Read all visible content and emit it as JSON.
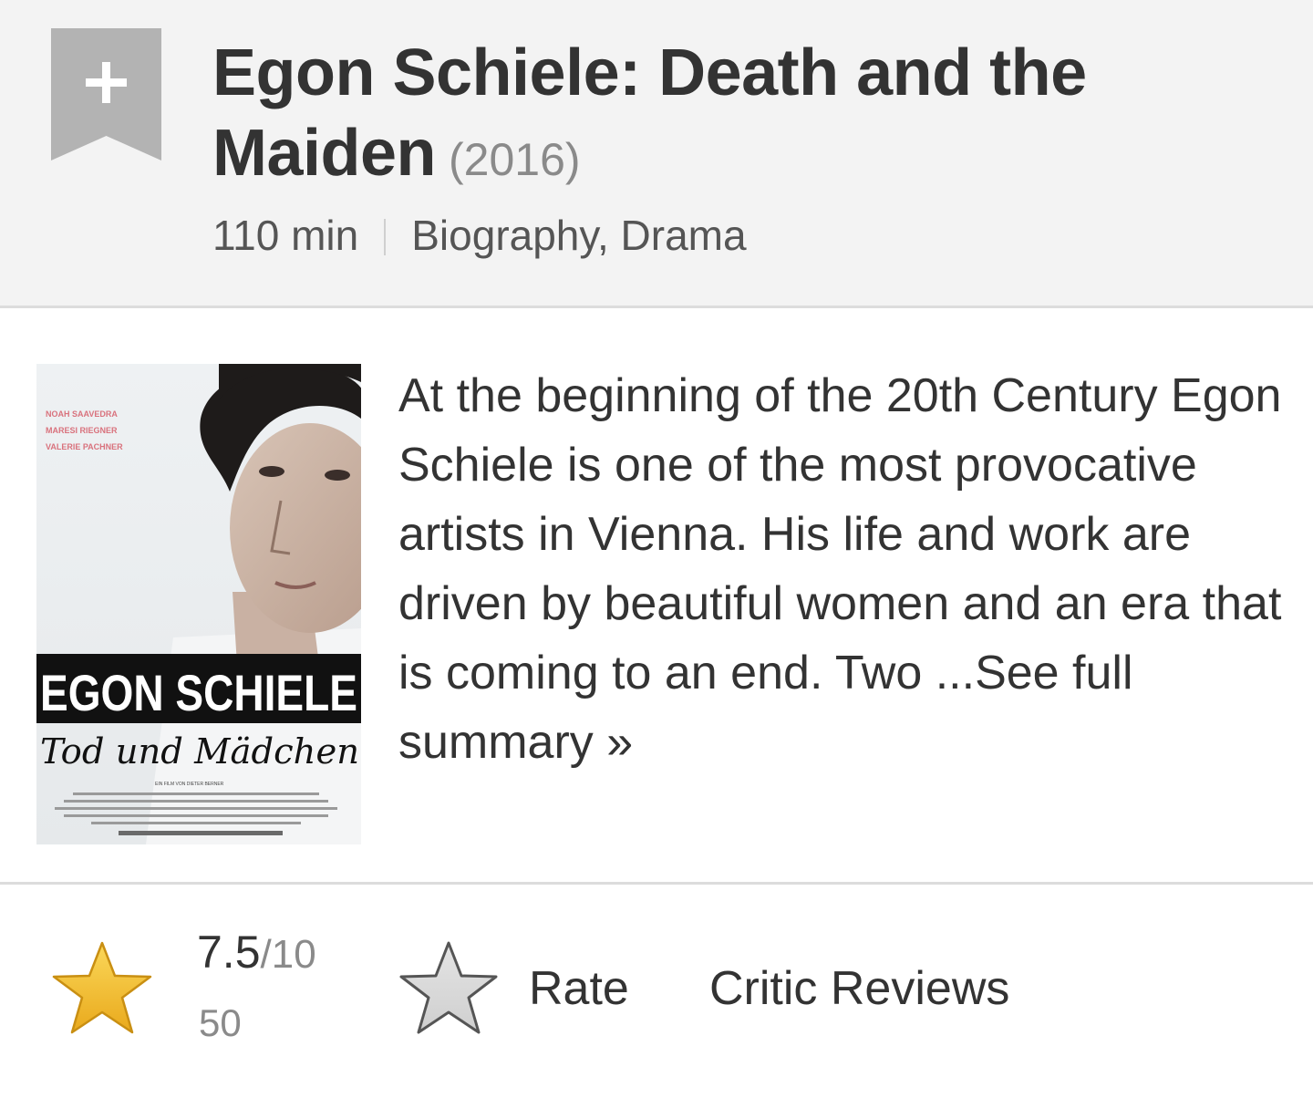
{
  "header": {
    "watchlist_icon": "plus-ribbon-icon",
    "title": "Egon Schiele: Death and the Maiden",
    "year": "(2016)",
    "runtime": "110 min",
    "genres": "Biography, Drama"
  },
  "summary": {
    "poster": {
      "cast_lines": [
        "NOAH SAAVEDRA",
        "MARESI RIEGNER",
        "VALERIE PACHNER"
      ],
      "poster_title": "EGON SCHIELE",
      "poster_subtitle": "Tod und Mädchen",
      "poster_credit": "EIN FILM VON DIETER BERNER"
    },
    "plot": "At the beginning of the 20th Century Egon Schiele is one of the most provocative artists in Vienna. His life and work are driven by beautiful women and an era that is coming to an end. Two ...",
    "see_more_label": "See full summary »"
  },
  "rating": {
    "icon": "star-icon",
    "value": "7.5",
    "out_of": "/10",
    "count": "50",
    "rate_icon": "star-outline-icon",
    "rate_label": "Rate",
    "critic_reviews_label": "Critic Reviews"
  },
  "colors": {
    "header_bg": "#f3f3f3",
    "divider": "#dcdcdc",
    "text": "#333333",
    "muted": "#8a8a8a",
    "star_gold": "#f5c518",
    "star_grey": "#d6d6d6"
  }
}
